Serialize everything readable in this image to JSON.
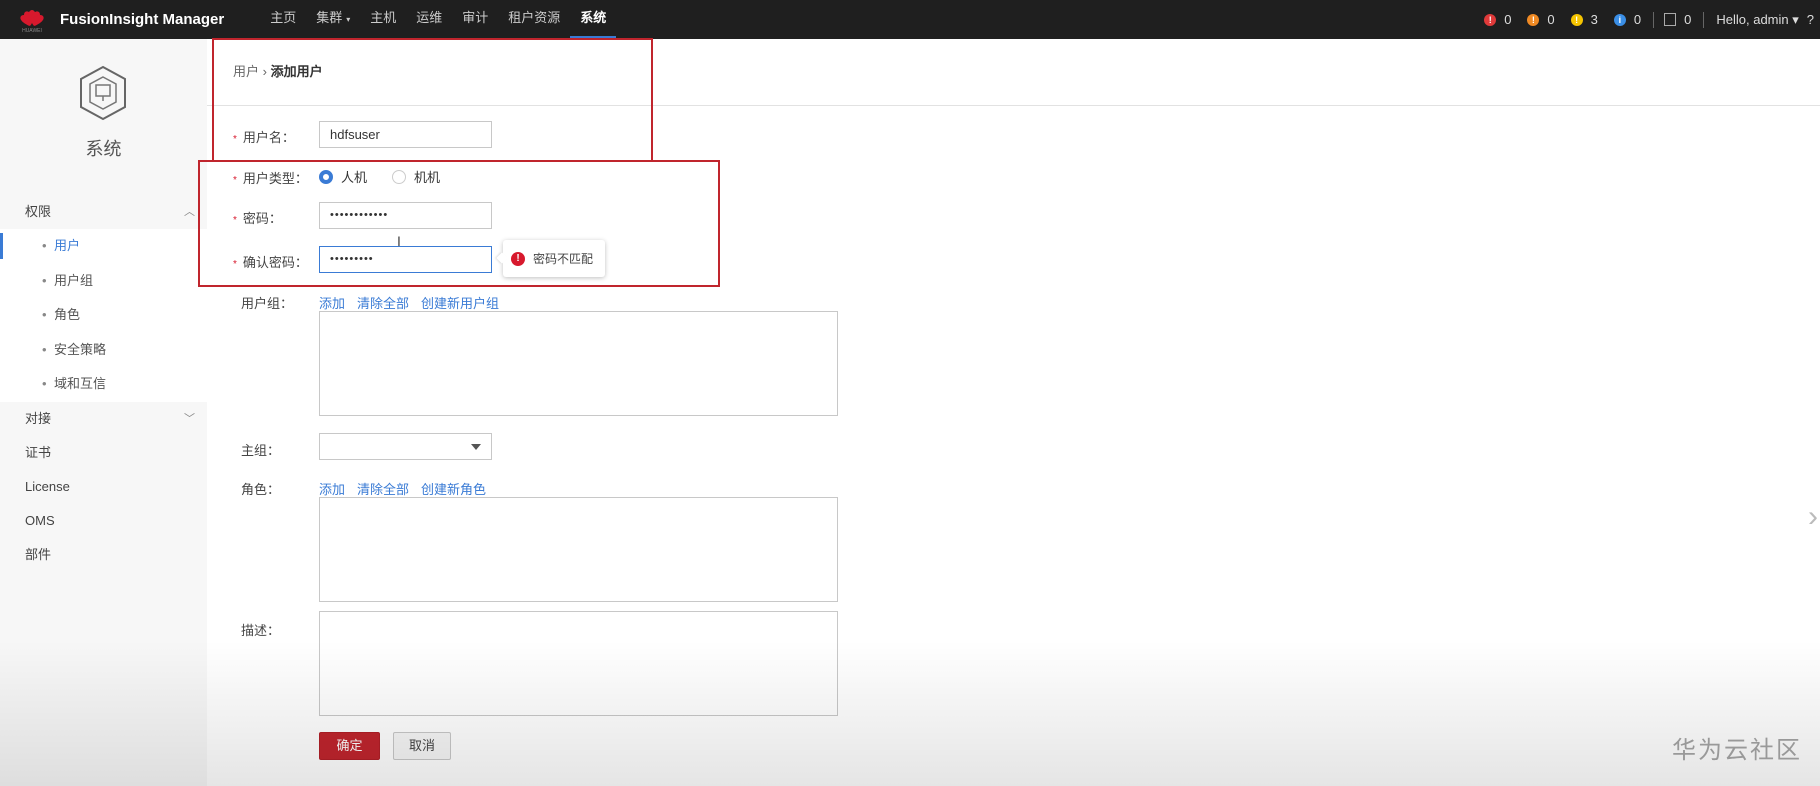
{
  "topbar": {
    "brand": "FusionInsight Manager",
    "logo_text": "HUAWEI",
    "nav": [
      {
        "label": "主页"
      },
      {
        "label": "集群",
        "caret": "▾"
      },
      {
        "label": "主机"
      },
      {
        "label": "运维"
      },
      {
        "label": "审计"
      },
      {
        "label": "租户资源"
      },
      {
        "label": "系统"
      }
    ],
    "alarms": [
      {
        "count": "0",
        "color": "#e03a3a"
      },
      {
        "count": "0",
        "color": "#f08a24"
      },
      {
        "count": "3",
        "color": "#f5c400"
      },
      {
        "count": "0",
        "color": "#3a8ee6"
      }
    ],
    "messages_count": "0",
    "user": "Hello, admin ▾",
    "extra": "?"
  },
  "sidebar": {
    "title": "系统",
    "groups": [
      {
        "label": "权限",
        "chev": "︿"
      },
      {
        "label": "对接",
        "chev": "﹀"
      },
      {
        "label": "证书"
      },
      {
        "label": "License"
      },
      {
        "label": "OMS"
      },
      {
        "label": "部件"
      }
    ],
    "items": [
      {
        "label": "用户"
      },
      {
        "label": "用户组"
      },
      {
        "label": "角色"
      },
      {
        "label": "安全策略"
      },
      {
        "label": "域和互信"
      }
    ]
  },
  "breadcrumb": {
    "parent": "用户",
    "sep": "›",
    "current": "添加用户"
  },
  "form": {
    "username_label": "用户名：",
    "username_value": "hdfsuser",
    "usertype_label": "用户类型：",
    "usertype_options": [
      "人机",
      "机机"
    ],
    "password_label": "密码：",
    "password_value": "••••••••••••",
    "confirm_label": "确认密码：",
    "confirm_value": "•••••••••",
    "error_tip": "密码不匹配",
    "usergroup_label": "用户组：",
    "primary_group_label": "主组：",
    "role_label": "角色：",
    "desc_label": "描述：",
    "group_links": [
      "添加",
      "清除全部",
      "创建新用户组"
    ],
    "role_links": [
      "添加",
      "清除全部",
      "创建新角色"
    ],
    "ok": "确定",
    "cancel": "取消"
  },
  "watermark": "华为云社区"
}
